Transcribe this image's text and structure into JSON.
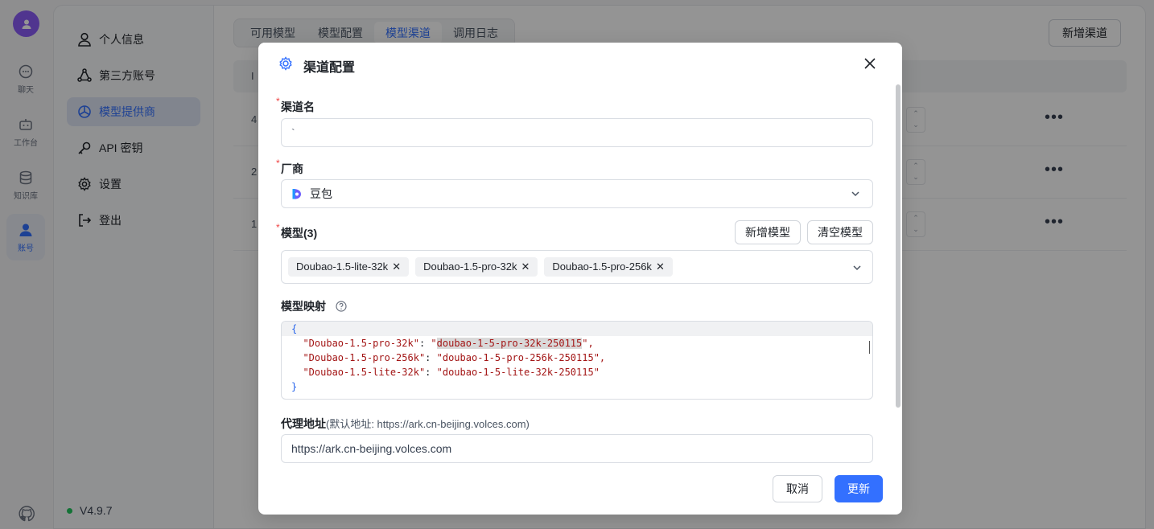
{
  "rail": {
    "items": [
      {
        "label": "聊天",
        "icon": "chat-icon"
      },
      {
        "label": "工作台",
        "icon": "robot-icon"
      },
      {
        "label": "知识库",
        "icon": "database-icon"
      },
      {
        "label": "账号",
        "icon": "user-icon",
        "active": true
      }
    ]
  },
  "sidebar": {
    "items": [
      {
        "label": "个人信息",
        "icon": "user-outline-icon"
      },
      {
        "label": "第三方账号",
        "icon": "link-icon"
      },
      {
        "label": "模型提供商",
        "icon": "model-provider-icon",
        "active": true
      },
      {
        "label": "API 密钥",
        "icon": "key-icon"
      },
      {
        "label": "设置",
        "icon": "gear-icon"
      },
      {
        "label": "登出",
        "icon": "logout-icon"
      }
    ],
    "version": "V4.9.7"
  },
  "main": {
    "tabs": [
      {
        "label": "可用模型"
      },
      {
        "label": "模型配置"
      },
      {
        "label": "模型渠道",
        "active": true
      },
      {
        "label": "调用日志"
      }
    ],
    "add_channel_label": "新增渠道",
    "table": {
      "header_first": "I",
      "header_partial": ")",
      "rows": [
        {
          "id": "4"
        },
        {
          "id": "2"
        },
        {
          "id": "1"
        }
      ],
      "more_label": "•••"
    }
  },
  "modal": {
    "title": "渠道配置",
    "channel_name": {
      "label": "渠道名",
      "value": "`"
    },
    "vendor": {
      "label": "厂商",
      "value": "豆包"
    },
    "models": {
      "label": "模型(3)",
      "add_label": "新增模型",
      "clear_label": "清空模型",
      "tags": [
        "Doubao-1.5-lite-32k",
        "Doubao-1.5-pro-32k",
        "Doubao-1.5-pro-256k"
      ]
    },
    "mapping": {
      "label": "模型映射",
      "lines": {
        "open": "{",
        "l1_key": "\"Doubao-1.5-pro-32k\"",
        "l1_val_q1": "\"",
        "l1_val_sel": "doubao-1-5-pro-32k-250115",
        "l1_val_q2": "\",",
        "l2_key": "\"Doubao-1.5-pro-256k\"",
        "l2_val": "\"doubao-1-5-pro-256k-250115\",",
        "l3_key": "\"Doubao-1.5-lite-32k\"",
        "l3_val": "\"doubao-1-5-lite-32k-250115\"",
        "close": "}"
      }
    },
    "proxy": {
      "label": "代理地址",
      "hint": "(默认地址: https://ark.cn-beijing.volces.com)",
      "value": "https://ark.cn-beijing.volces.com"
    },
    "cancel_label": "取消",
    "update_label": "更新"
  },
  "colors": {
    "accent": "#3370ff",
    "avatar": "#8b5cf6",
    "status_online": "#22c55e",
    "required": "#ef4444"
  }
}
